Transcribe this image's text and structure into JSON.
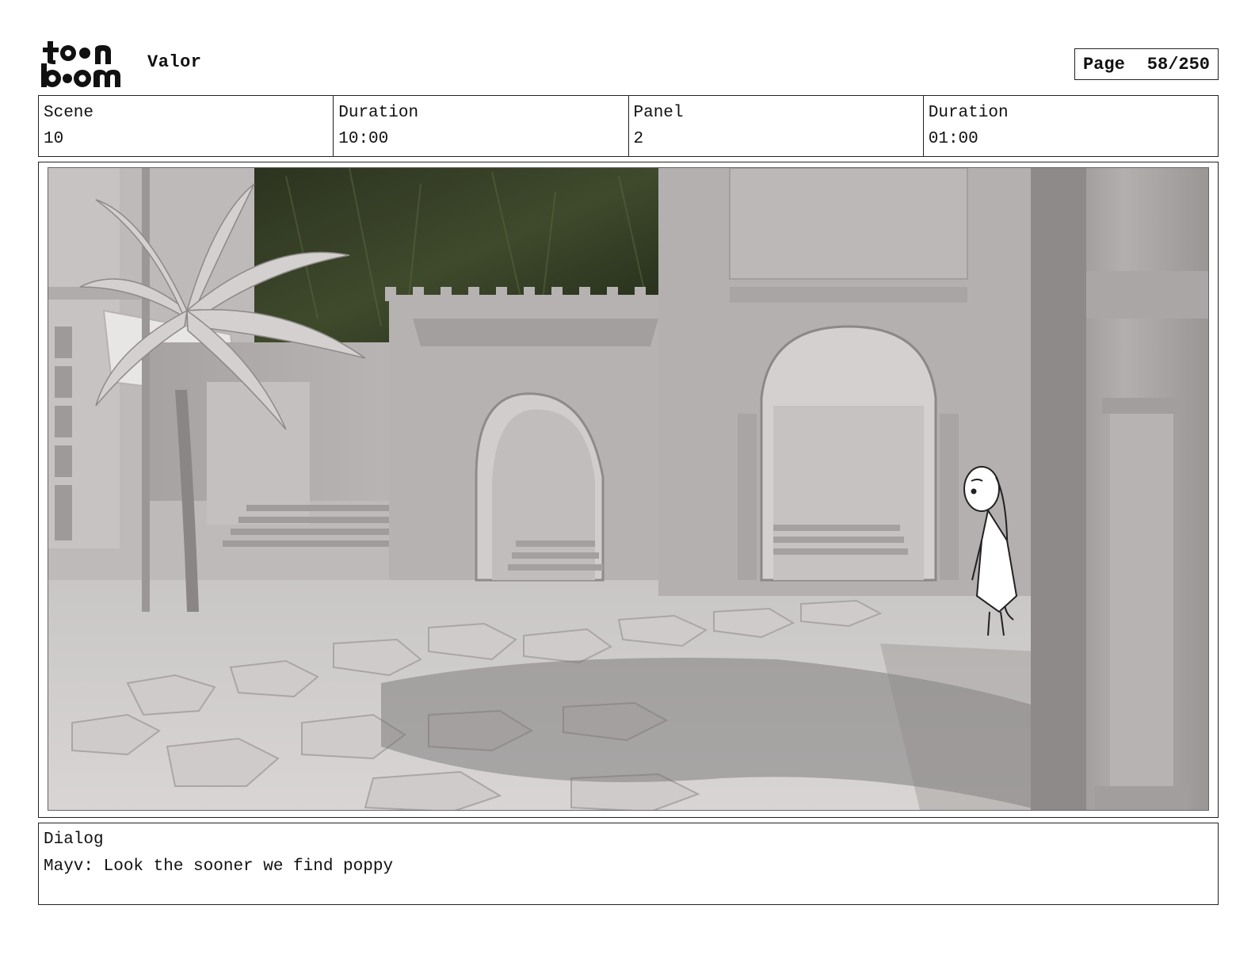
{
  "header": {
    "logo_text_top": "toon",
    "logo_text_bottom": "boom",
    "project_title": "Valor",
    "page_label": "Page",
    "page_value": "58/250"
  },
  "info": {
    "scene_label": "Scene",
    "scene_value": "10",
    "scene_duration_label": "Duration",
    "scene_duration_value": "10:00",
    "panel_label": "Panel",
    "panel_value": "2",
    "panel_duration_label": "Duration",
    "panel_duration_value": "01:00"
  },
  "dialog": {
    "label": "Dialog",
    "text": "Mayv: Look the sooner we find poppy"
  }
}
